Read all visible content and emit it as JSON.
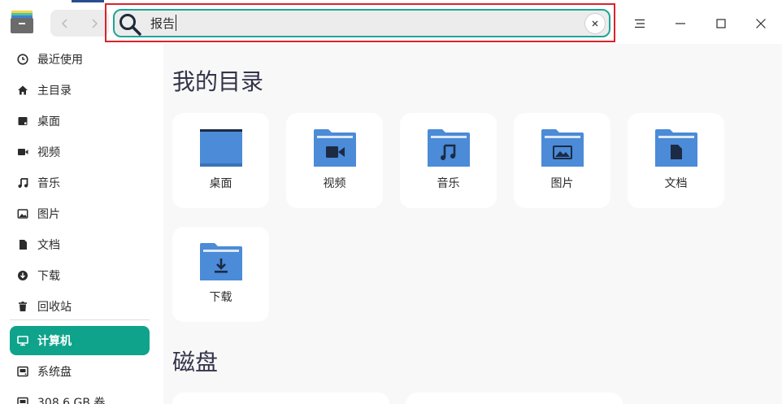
{
  "titlebar": {
    "app_icon": "file-manager-icon",
    "back_icon": "chevron-left-icon",
    "forward_icon": "chevron-right-icon",
    "menu_icon": "hamburger-menu-icon",
    "minimize_icon": "minimize-icon",
    "maximize_icon": "maximize-icon",
    "close_icon": "close-icon"
  },
  "search": {
    "value": "报告",
    "clear_icon": "clear-icon"
  },
  "sidebar": {
    "items": [
      {
        "label": "最近使用",
        "icon": "clock-icon"
      },
      {
        "label": "主目录",
        "icon": "home-icon"
      },
      {
        "label": "桌面",
        "icon": "desktop-icon"
      },
      {
        "label": "视频",
        "icon": "video-icon"
      },
      {
        "label": "音乐",
        "icon": "music-icon"
      },
      {
        "label": "图片",
        "icon": "picture-icon"
      },
      {
        "label": "文档",
        "icon": "document-icon"
      },
      {
        "label": "下载",
        "icon": "download-icon"
      },
      {
        "label": "回收站",
        "icon": "trash-icon"
      },
      {
        "label": "计算机",
        "icon": "computer-icon",
        "active": true
      },
      {
        "label": "系统盘",
        "icon": "disk-icon"
      },
      {
        "label": "308.6 GB 卷",
        "icon": "disk-icon"
      }
    ]
  },
  "main": {
    "my_dirs_title": "我的目录",
    "dirs": [
      {
        "label": "桌面",
        "icon": "desktop-folder-icon"
      },
      {
        "label": "视频",
        "icon": "video-folder-icon"
      },
      {
        "label": "音乐",
        "icon": "music-folder-icon"
      },
      {
        "label": "图片",
        "icon": "picture-folder-icon"
      },
      {
        "label": "文档",
        "icon": "document-folder-icon"
      },
      {
        "label": "下载",
        "icon": "download-folder-icon"
      }
    ],
    "disks_title": "磁盘"
  },
  "colors": {
    "accent": "#0fa38c",
    "folder": "#4b8bd8",
    "search_highlight": "#d9232a"
  }
}
